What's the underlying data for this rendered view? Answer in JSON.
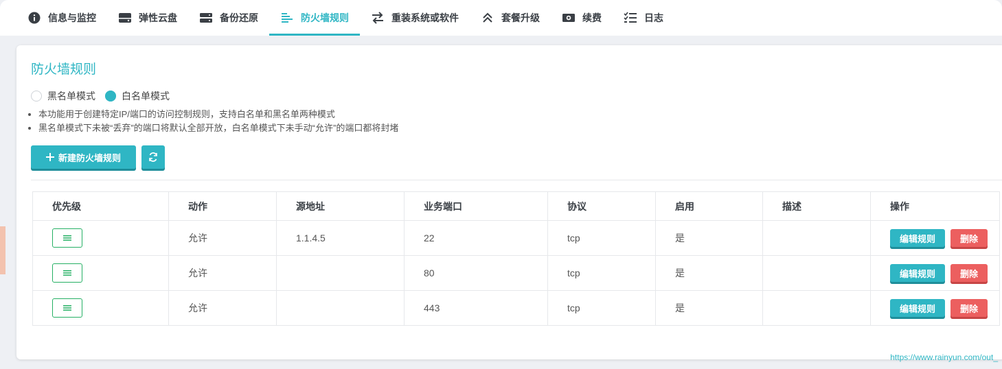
{
  "tabs": [
    {
      "label": "信息与监控",
      "icon": "info-icon",
      "active": false
    },
    {
      "label": "弹性云盘",
      "icon": "disk-icon",
      "active": false
    },
    {
      "label": "备份还原",
      "icon": "server-icon",
      "active": false
    },
    {
      "label": "防火墙规则",
      "icon": "list-align-icon",
      "active": true
    },
    {
      "label": "重装系统或软件",
      "icon": "swap-icon",
      "active": false
    },
    {
      "label": "套餐升级",
      "icon": "upgrade-chevron-icon",
      "active": false
    },
    {
      "label": "续费",
      "icon": "money-icon",
      "active": false
    },
    {
      "label": "日志",
      "icon": "checklist-icon",
      "active": false
    }
  ],
  "page": {
    "title": "防火墙规则",
    "mode_options": [
      {
        "label": "黑名单模式",
        "selected": false
      },
      {
        "label": "白名单模式",
        "selected": true
      }
    ],
    "notes": [
      "本功能用于创建特定IP/端口的访问控制规则，支持白名单和黑名单两种模式",
      "黑名单模式下未被“丢弃”的端口将默认全部开放，白名单模式下未手动“允许”的端口都将封堵"
    ],
    "new_rule_label": "新建防火墙规则",
    "refresh_icon": "refresh-icon"
  },
  "table": {
    "headers": [
      "优先级",
      "动作",
      "源地址",
      "业务端口",
      "协议",
      "启用",
      "描述",
      "操作"
    ],
    "rows": [
      {
        "action": "允许",
        "source": "1.1.4.5",
        "port": "22",
        "protocol": "tcp",
        "enabled": "是",
        "desc": ""
      },
      {
        "action": "允许",
        "source": "",
        "port": "80",
        "protocol": "tcp",
        "enabled": "是",
        "desc": ""
      },
      {
        "action": "允许",
        "source": "",
        "port": "443",
        "protocol": "tcp",
        "enabled": "是",
        "desc": ""
      }
    ],
    "edit_label": "编辑规则",
    "delete_label": "删除"
  },
  "watermark": "https://www.rainyun.com/out_",
  "colors": {
    "accent": "#2fb6c4",
    "danger": "#ec5f5f",
    "drag_border": "#25b064"
  }
}
